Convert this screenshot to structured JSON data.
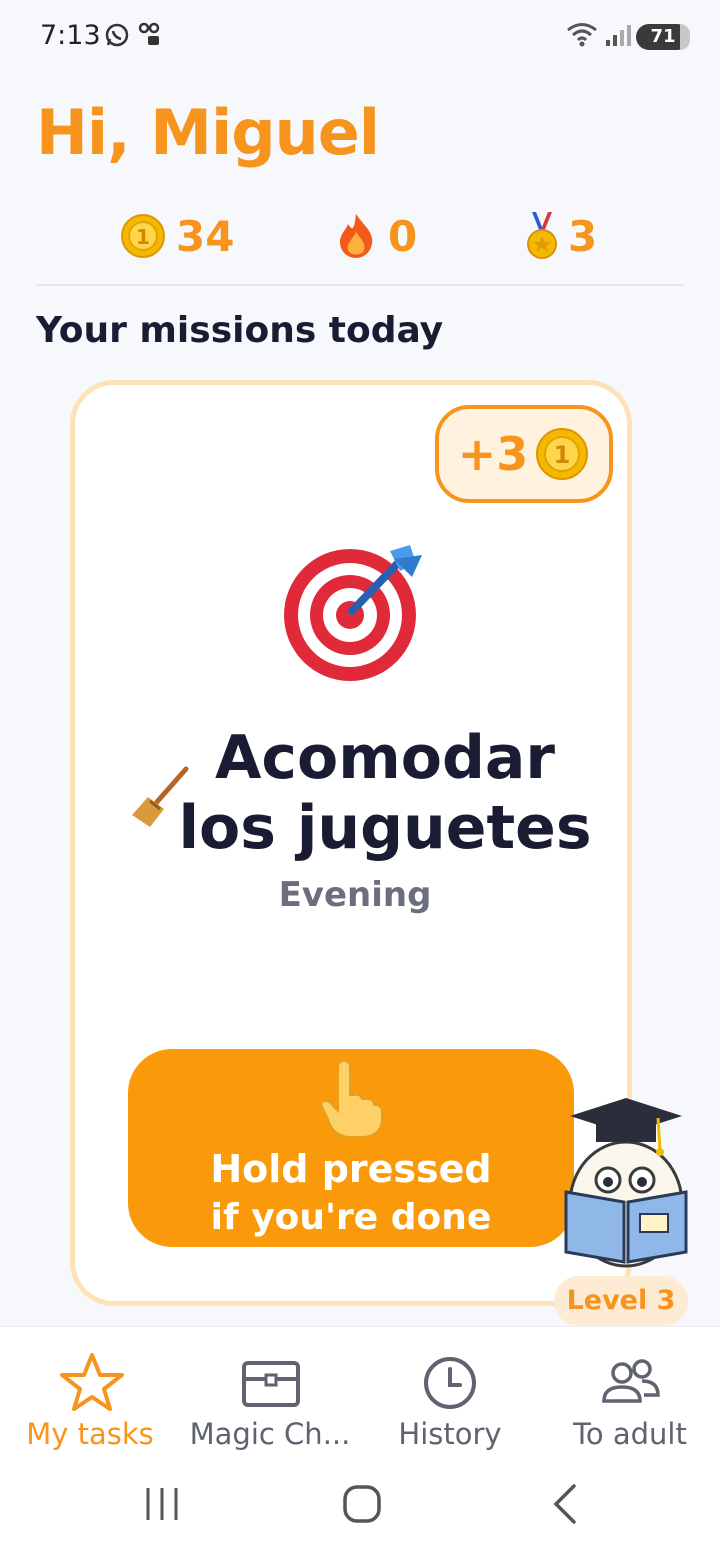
{
  "status_bar": {
    "time": "7:13",
    "battery": "71"
  },
  "header": {
    "greeting": "Hi, Miguel"
  },
  "stats": {
    "coins": "34",
    "streak": "0",
    "medals": "3"
  },
  "section": {
    "title": "Your missions today"
  },
  "mission": {
    "reward": "+3",
    "title": "Acomodar los juguetes",
    "time_of_day": "Evening",
    "button_line1": "Hold pressed",
    "button_line2": "if you're done"
  },
  "level": {
    "label": "Level 3"
  },
  "nav": {
    "items": [
      {
        "label": "My tasks",
        "icon": "star-icon",
        "active": true
      },
      {
        "label": "Magic Ch...",
        "icon": "chest-icon",
        "active": false
      },
      {
        "label": "History",
        "icon": "clock-icon",
        "active": false
      },
      {
        "label": "To adult",
        "icon": "users-icon",
        "active": false
      }
    ]
  },
  "colors": {
    "accent": "#f7941d",
    "button": "#fa9a0a",
    "text": "#1a1c33",
    "muted": "#6b6e7c"
  }
}
